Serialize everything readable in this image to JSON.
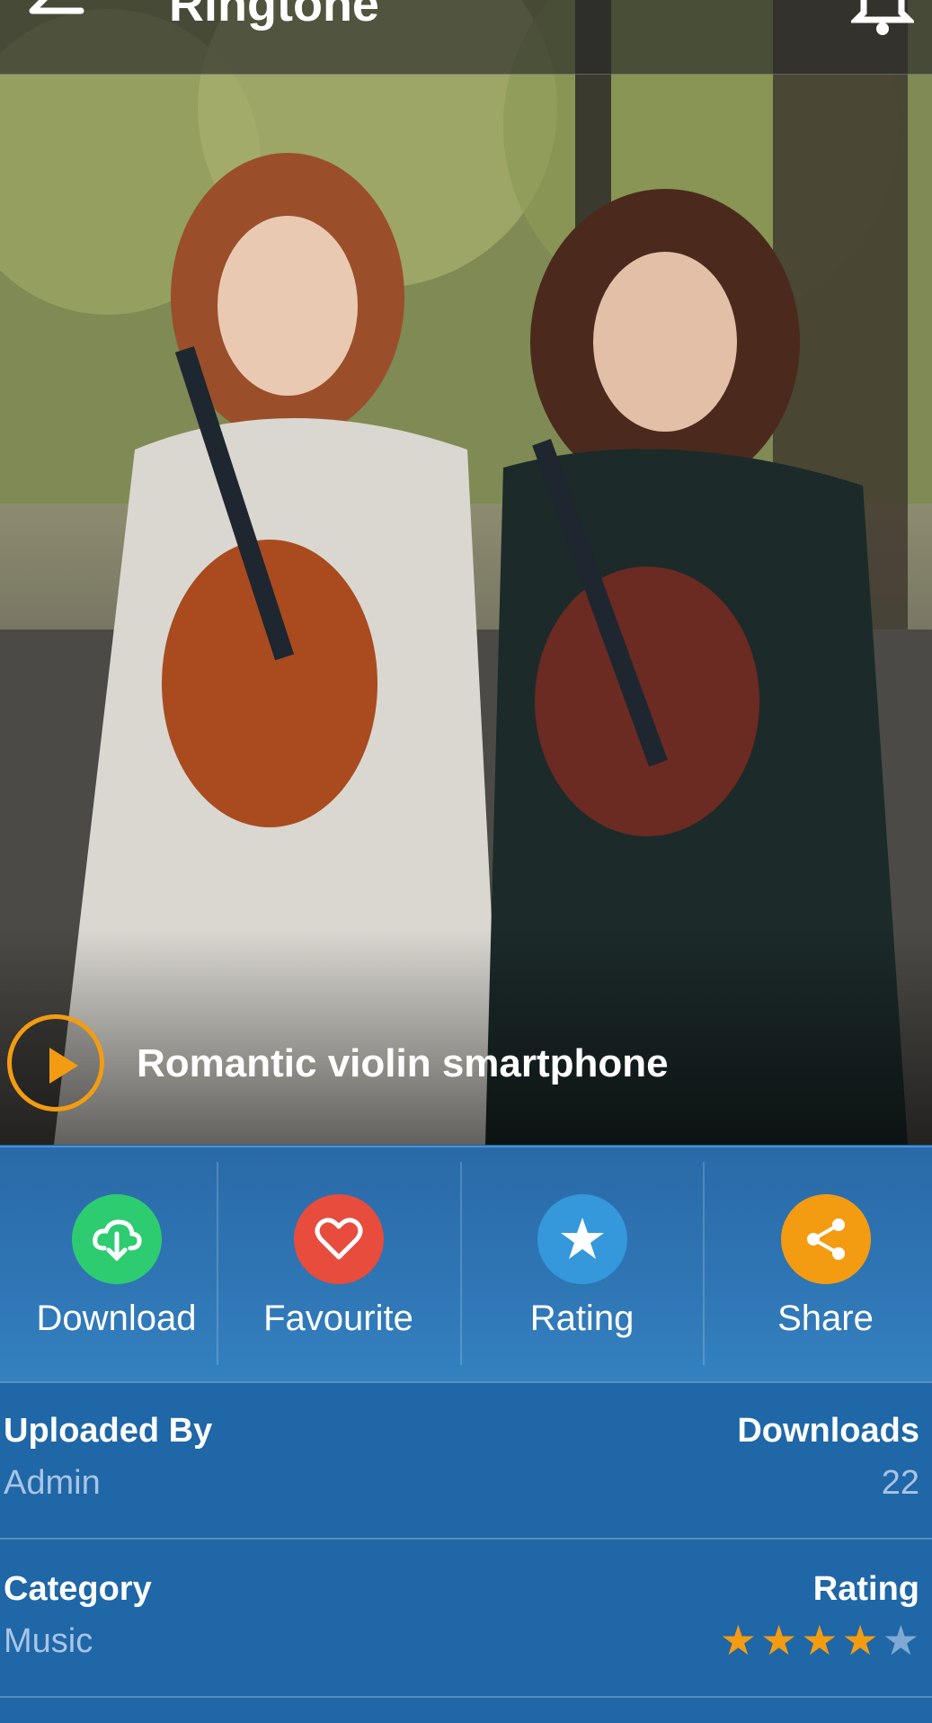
{
  "appbar": {
    "title": "Ringtone"
  },
  "player": {
    "song_title": "Romantic violin smartphone"
  },
  "actions": [
    {
      "label": "Download",
      "color": "#2ecc71",
      "icon": "cloud-download-icon"
    },
    {
      "label": "Favourite",
      "color": "#e74c3c",
      "icon": "heart-icon"
    },
    {
      "label": "Rating",
      "color": "#3498db",
      "icon": "star-icon"
    },
    {
      "label": "Share",
      "color": "#f39c12",
      "icon": "share-icon"
    }
  ],
  "details": {
    "uploaded_by_label": "Uploaded By",
    "uploaded_by_value": "Admin",
    "downloads_label": "Downloads",
    "downloads_value": "22",
    "category_label": "Category",
    "category_value": "Music",
    "rating_label": "Rating",
    "rating_value": 4,
    "rating_max": 5
  },
  "colors": {
    "accent": "#f39c12",
    "panel_bg": "#1f67a6",
    "muted_text": "#a8c4e6"
  }
}
